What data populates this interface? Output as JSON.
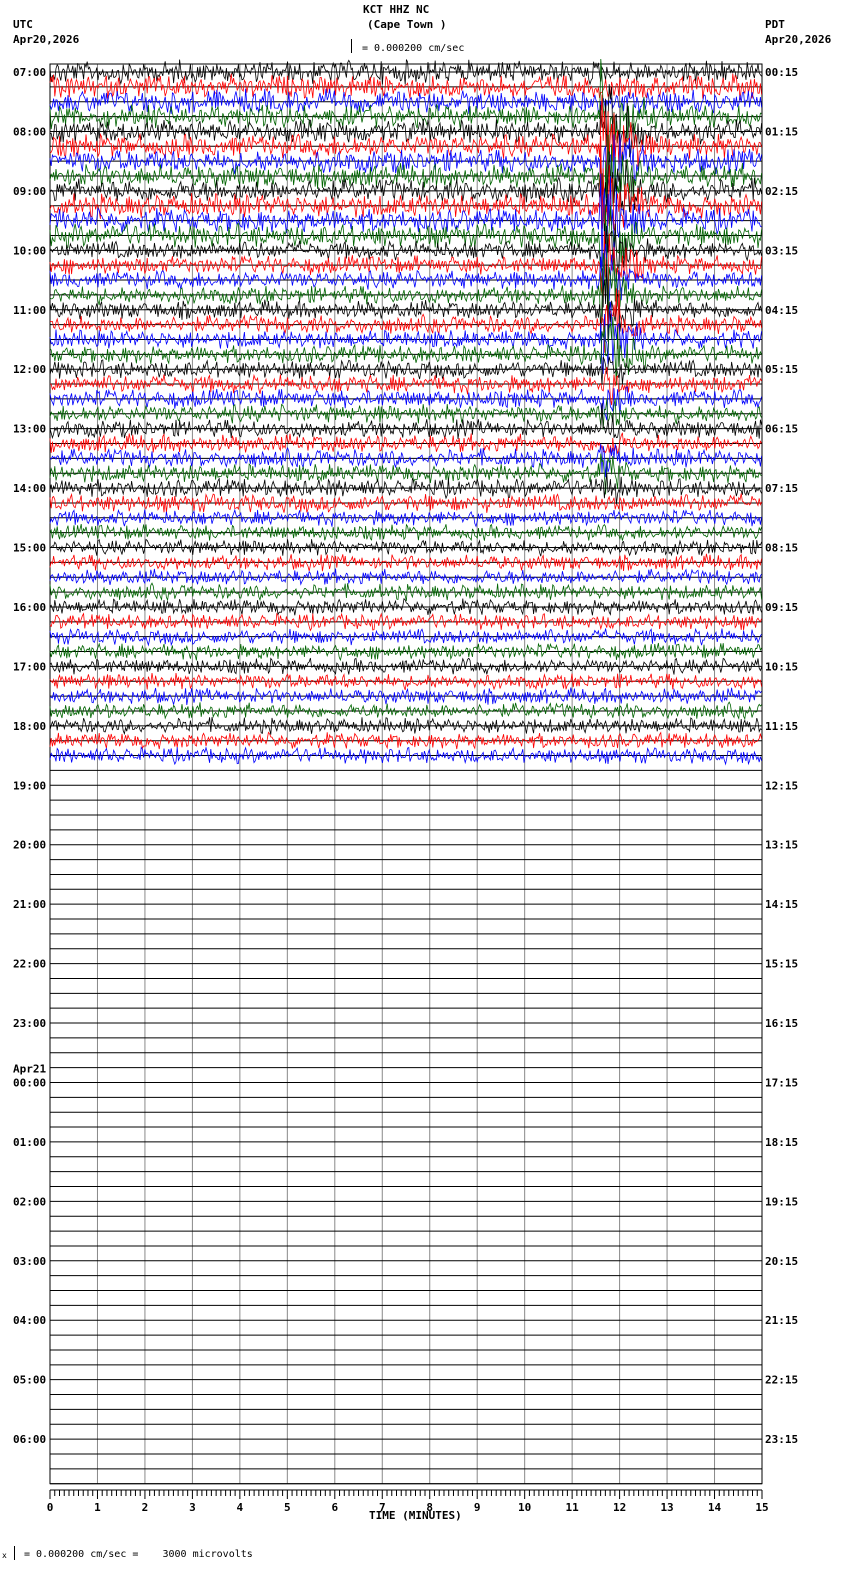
{
  "header": {
    "station": "KCT HHZ NC",
    "location": "(Cape Town )",
    "left_tz": "UTC",
    "left_date": "Apr20,2026",
    "right_tz": "PDT",
    "right_date": "Apr20,2026",
    "scale_text": "= 0.000200 cm/sec"
  },
  "footer": {
    "scale_text": "= 0.000200 cm/sec =    3000 microvolts",
    "mark": "x"
  },
  "chart_data": {
    "type": "line",
    "title": "KCT HHZ NC (Cape Town )",
    "xlabel": "TIME (MINUTES)",
    "ylabel": "",
    "xlim": [
      0,
      15
    ],
    "x_ticks": [
      "0",
      "1",
      "2",
      "3",
      "4",
      "5",
      "6",
      "7",
      "8",
      "9",
      "10",
      "11",
      "12",
      "13",
      "14",
      "15"
    ],
    "left_labels": [
      "07:00",
      "08:00",
      "09:00",
      "10:00",
      "11:00",
      "12:00",
      "13:00",
      "14:00",
      "15:00",
      "16:00",
      "17:00",
      "18:00",
      "19:00",
      "20:00",
      "21:00",
      "22:00",
      "23:00",
      "00:00",
      "01:00",
      "02:00",
      "03:00",
      "04:00",
      "05:00",
      "06:00"
    ],
    "date_change_label": "Apr21",
    "right_labels": [
      "00:15",
      "01:15",
      "02:15",
      "03:15",
      "04:15",
      "05:15",
      "06:15",
      "07:15",
      "08:15",
      "09:15",
      "10:15",
      "11:15",
      "12:15",
      "13:15",
      "14:15",
      "15:15",
      "16:15",
      "17:15",
      "18:15",
      "19:15",
      "20:15",
      "21:15",
      "22:15",
      "23:15"
    ],
    "traces_per_hour": 4,
    "trace_rows_total": 96,
    "trace_rows_with_data": 47,
    "trace_colors": [
      "#000000",
      "#ff0000",
      "#0000ff",
      "#006400"
    ],
    "event": {
      "start_minute": 11.6,
      "end_minute": 12.6,
      "first_row": 3,
      "last_row": 28
    }
  }
}
